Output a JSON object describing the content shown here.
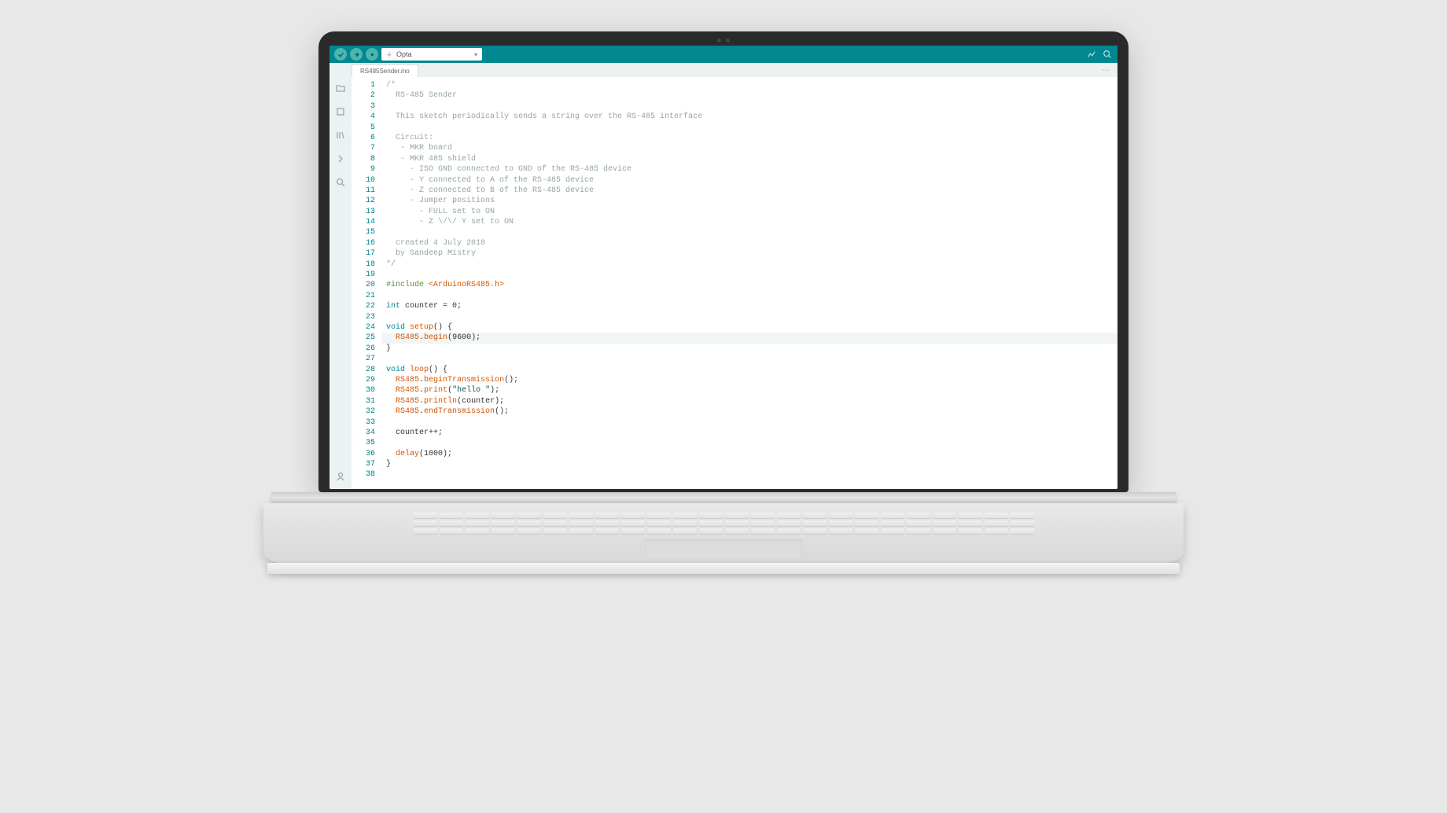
{
  "toolbar": {
    "board": "Opta"
  },
  "tab": {
    "name": "RS485Sender.ino"
  },
  "code": {
    "total_lines": 38,
    "highlighted_line": 25,
    "lines": [
      {
        "n": 1,
        "t": "comment",
        "text": "/*"
      },
      {
        "n": 2,
        "t": "comment",
        "text": "  RS-485 Sender"
      },
      {
        "n": 3,
        "t": "comment",
        "text": ""
      },
      {
        "n": 4,
        "t": "comment",
        "text": "  This sketch periodically sends a string over the RS-485 interface"
      },
      {
        "n": 5,
        "t": "comment",
        "text": ""
      },
      {
        "n": 6,
        "t": "comment",
        "text": "  Circuit:"
      },
      {
        "n": 7,
        "t": "comment",
        "text": "   - MKR board"
      },
      {
        "n": 8,
        "t": "comment",
        "text": "   - MKR 485 shield"
      },
      {
        "n": 9,
        "t": "comment",
        "text": "     - ISO GND connected to GND of the RS-485 device"
      },
      {
        "n": 10,
        "t": "comment",
        "text": "     - Y connected to A of the RS-485 device"
      },
      {
        "n": 11,
        "t": "comment",
        "text": "     - Z connected to B of the RS-485 device"
      },
      {
        "n": 12,
        "t": "comment",
        "text": "     - Jumper positions"
      },
      {
        "n": 13,
        "t": "comment",
        "text": "       - FULL set to ON"
      },
      {
        "n": 14,
        "t": "comment",
        "text": "       - Z \\/\\/ Y set to ON"
      },
      {
        "n": 15,
        "t": "comment",
        "text": ""
      },
      {
        "n": 16,
        "t": "comment",
        "text": "  created 4 July 2018"
      },
      {
        "n": 17,
        "t": "comment",
        "text": "  by Sandeep Mistry"
      },
      {
        "n": 18,
        "t": "comment",
        "text": "*/"
      },
      {
        "n": 19,
        "t": "blank",
        "text": ""
      },
      {
        "n": 20,
        "t": "include",
        "pre": "#include ",
        "inc": "<ArduinoRS485.h>"
      },
      {
        "n": 21,
        "t": "blank",
        "text": ""
      },
      {
        "n": 22,
        "t": "decl",
        "type": "int ",
        "rest": "counter = 0;"
      },
      {
        "n": 23,
        "t": "blank",
        "text": ""
      },
      {
        "n": 24,
        "t": "funchead",
        "type": "void ",
        "name": "setup",
        "tail": "() {"
      },
      {
        "n": 25,
        "t": "call",
        "indent": "  ",
        "obj": "RS485",
        "dot": ".",
        "method": "begin",
        "args": "(9600);"
      },
      {
        "n": 26,
        "t": "plain",
        "text": "}"
      },
      {
        "n": 27,
        "t": "blank",
        "text": ""
      },
      {
        "n": 28,
        "t": "funchead",
        "type": "void ",
        "name": "loop",
        "tail": "() {"
      },
      {
        "n": 29,
        "t": "call",
        "indent": "  ",
        "obj": "RS485",
        "dot": ".",
        "method": "beginTransmission",
        "args": "();"
      },
      {
        "n": 30,
        "t": "callstr",
        "indent": "  ",
        "obj": "RS485",
        "dot": ".",
        "method": "print",
        "open": "(",
        "str": "\"hello \"",
        "close": ");"
      },
      {
        "n": 31,
        "t": "call",
        "indent": "  ",
        "obj": "RS485",
        "dot": ".",
        "method": "println",
        "args": "(counter);"
      },
      {
        "n": 32,
        "t": "call",
        "indent": "  ",
        "obj": "RS485",
        "dot": ".",
        "method": "endTransmission",
        "args": "();"
      },
      {
        "n": 33,
        "t": "blank",
        "text": ""
      },
      {
        "n": 34,
        "t": "plain",
        "text": "  counter++;"
      },
      {
        "n": 35,
        "t": "blank",
        "text": ""
      },
      {
        "n": 36,
        "t": "callfn",
        "indent": "  ",
        "method": "delay",
        "args": "(1000);"
      },
      {
        "n": 37,
        "t": "plain",
        "text": "}"
      },
      {
        "n": 38,
        "t": "blank",
        "text": ""
      }
    ]
  }
}
